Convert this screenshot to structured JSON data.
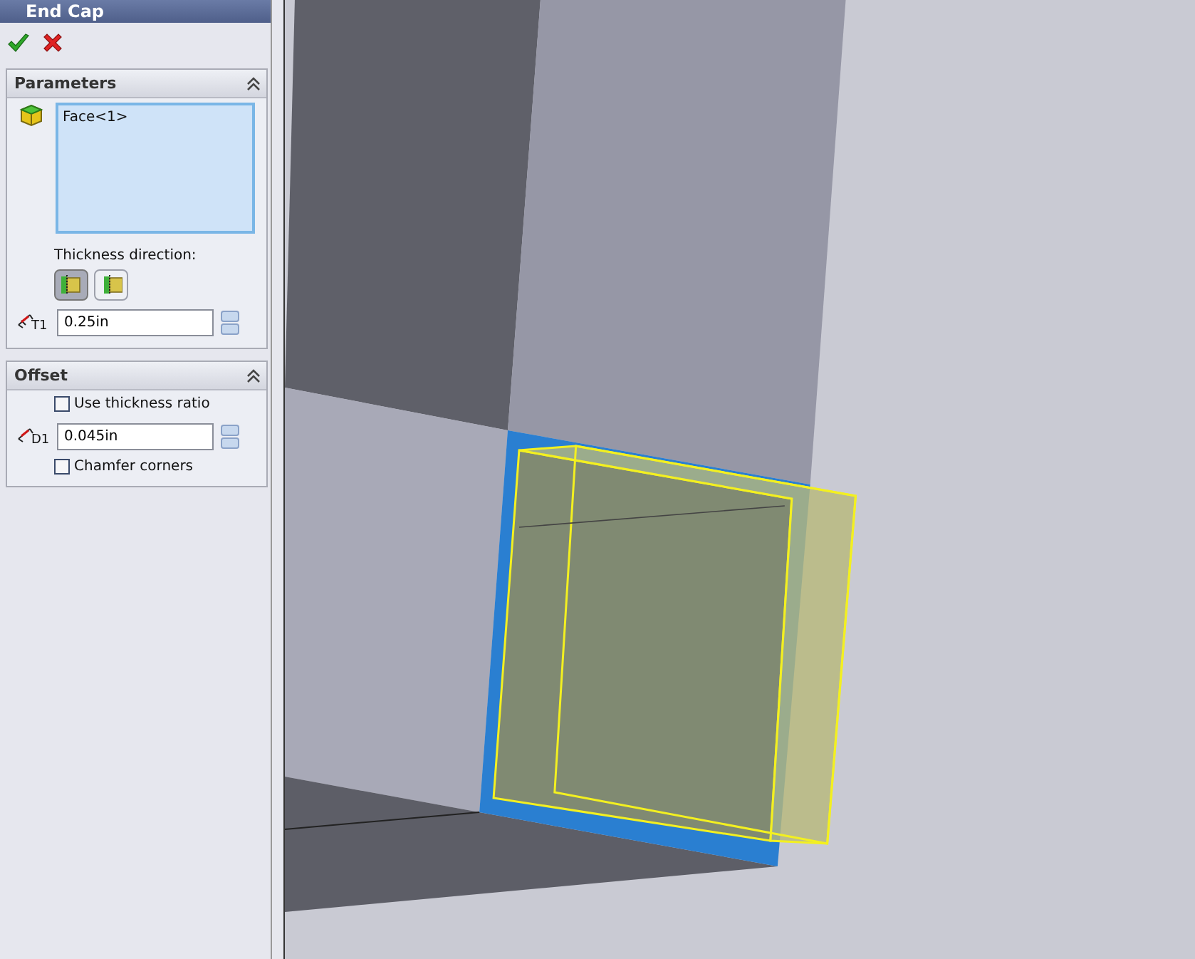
{
  "window": {
    "title": "End Cap"
  },
  "parameters": {
    "title": "Parameters",
    "expanded": true,
    "selection": [
      "Face<1>"
    ],
    "direction_label": "Thickness direction:",
    "direction_buttons": [
      {
        "selected": true
      },
      {
        "selected": false
      }
    ],
    "thickness": {
      "icon_label": "T1",
      "value": "0.25in"
    }
  },
  "offset": {
    "title": "Offset",
    "expanded": true,
    "use_ratio": {
      "label": "Use thickness ratio",
      "checked": false
    },
    "distance": {
      "icon_label": "D1",
      "value": "0.045in"
    },
    "chamfer": {
      "label": "Chamfer corners",
      "checked": false
    }
  }
}
